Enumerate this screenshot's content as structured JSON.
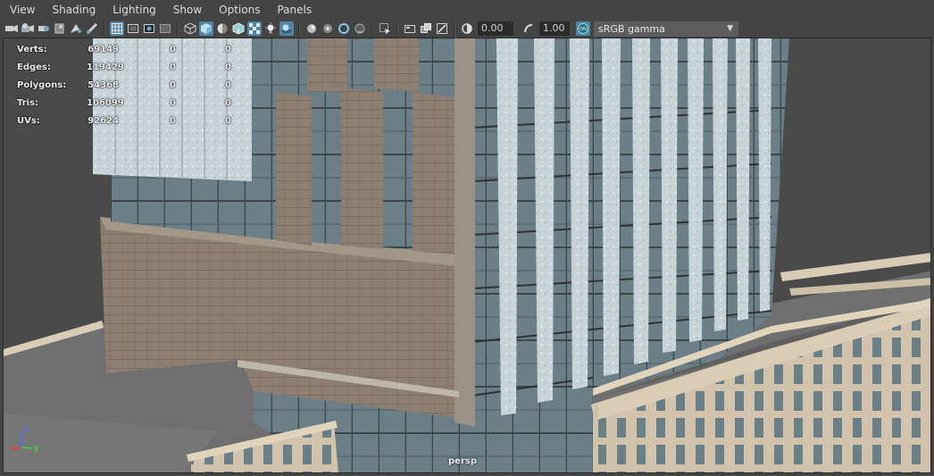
{
  "menu": [
    "View",
    "Shading",
    "Lighting",
    "Show",
    "Options",
    "Panels"
  ],
  "toolbar": {
    "exposure_value": "0.00",
    "gamma_value": "1.00",
    "color_space": "sRGB gamma"
  },
  "hud": {
    "rows": [
      {
        "label": "Verts:",
        "v1": "69149",
        "v2": "0",
        "v3": "0"
      },
      {
        "label": "Edges:",
        "v1": "119429",
        "v2": "0",
        "v3": "0"
      },
      {
        "label": "Polygons:",
        "v1": "54368",
        "v2": "0",
        "v3": "0"
      },
      {
        "label": "Tris:",
        "v1": "106099",
        "v2": "0",
        "v3": "0"
      },
      {
        "label": "UVs:",
        "v1": "92624",
        "v2": "0",
        "v3": "0"
      }
    ]
  },
  "camera": "persp",
  "axis": {
    "x": "x",
    "y": "y",
    "z": "z"
  },
  "colors": {
    "ui_bg": "#444444",
    "accent": "#5285a6",
    "field_bg": "#2b2b2b",
    "axis_x": "#e53b3b",
    "axis_y": "#3fd13f",
    "axis_z": "#4a6bff"
  }
}
